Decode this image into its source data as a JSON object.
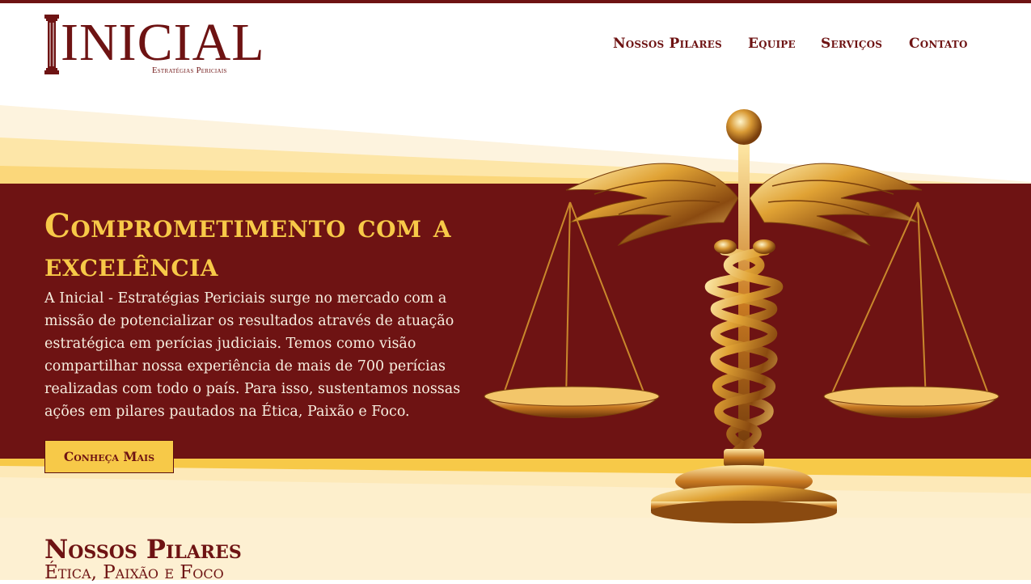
{
  "brand": {
    "name": "INICIAL",
    "tagline": "Estratégias Periciais",
    "primary_color": "#6e1313",
    "accent_color": "#f7c948",
    "cream_color": "#fdefcc"
  },
  "nav": {
    "items": [
      {
        "label": "Nossos Pilares"
      },
      {
        "label": "Equipe"
      },
      {
        "label": "Serviços"
      },
      {
        "label": "Contato"
      }
    ]
  },
  "hero": {
    "title": "Comprometimento com a excelência",
    "text": "A Inicial - Estratégias Periciais surge no mercado com a missão de potencializar os resultados através de atuação estratégica em perícias judiciais. Temos como visão compartilhar nossa experiência de mais de 700 perícias realizadas com todo o país. Para isso, sustentamos nossas ações em pilares pautados na Ética, Paixão e Foco.",
    "button_label": "Conheça Mais",
    "image_icon": "caduceus-scales-icon"
  },
  "pillars": {
    "title": "Nossos Pilares",
    "subtitle": "Ética, Paixão e Foco"
  }
}
